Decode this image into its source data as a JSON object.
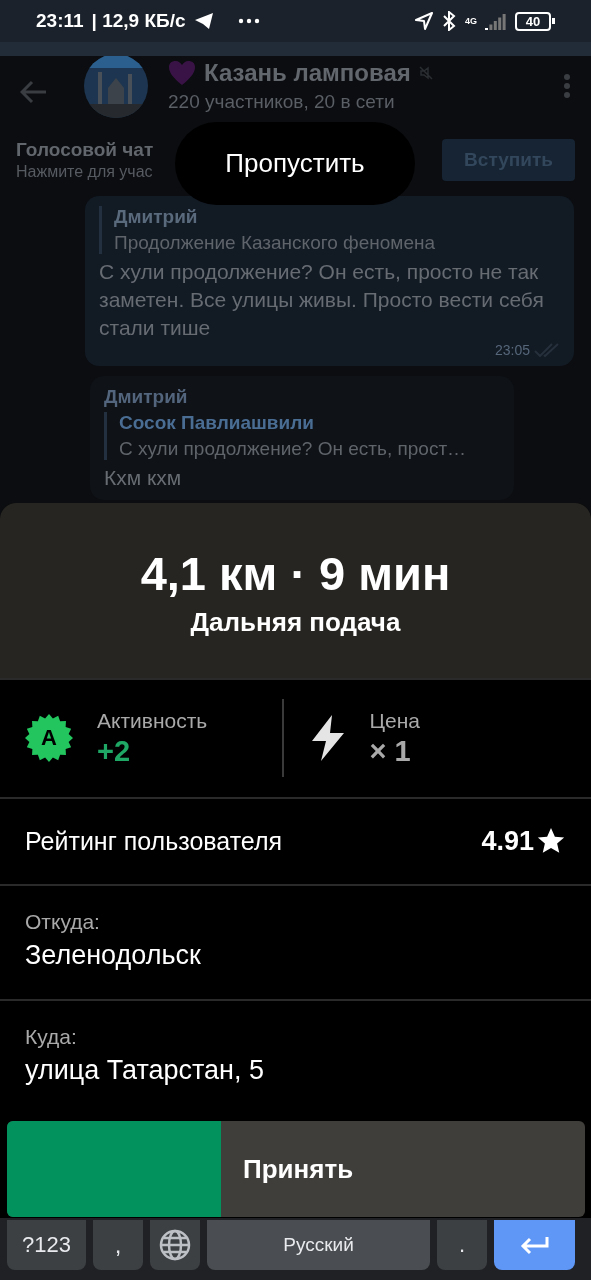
{
  "status_bar": {
    "time": "23:11",
    "speed": "| 12,9 КБ/с",
    "network": "4G",
    "battery": "40"
  },
  "chat": {
    "title": "Казань ламповая",
    "subtitle": "220 участников, 20 в сети",
    "voice_chat": {
      "title": "Голосовой чат",
      "hint": "Нажмите для учас",
      "button": "Вступить"
    },
    "messages": [
      {
        "outgoing": true,
        "quote_author": "Дмитрий",
        "quote_text": "Продолжение Казанского феномена",
        "text": "С хули продолжение? Он есть, просто не так заметен. Все улицы живы. Просто вести себя стали тише",
        "time": "23:05"
      },
      {
        "outgoing": false,
        "author": "Дмитрий",
        "quote_author": "Сосок Павлиашвили",
        "quote_text": "С хули продолжение? Он есть, прост…",
        "text": "Кхм кхм"
      }
    ]
  },
  "skip_button": "Пропустить",
  "order": {
    "distance": "4,1 км · 9 мин",
    "type": "Дальняя подача",
    "stats": [
      {
        "kind": "activity",
        "label": "Активность",
        "value": "+2",
        "badge": "A"
      },
      {
        "kind": "surge",
        "label": "Цена",
        "value": "× 1"
      }
    ],
    "rating": {
      "label": "Рейтинг пользователя",
      "value": "4.91"
    },
    "route": [
      {
        "label": "Откуда:",
        "value": "Зеленодольск"
      },
      {
        "label": "Куда:",
        "value": "улица Татарстан, 5"
      }
    ],
    "accept": {
      "label": "Принять",
      "level": 0.37
    }
  },
  "keyboard": {
    "keys": [
      {
        "kind": "symbols",
        "label": "?123"
      },
      {
        "kind": "comma",
        "label": ","
      },
      {
        "kind": "globe"
      },
      {
        "kind": "space",
        "label": "Русский"
      },
      {
        "kind": "period",
        "label": "."
      },
      {
        "kind": "enter"
      }
    ]
  }
}
